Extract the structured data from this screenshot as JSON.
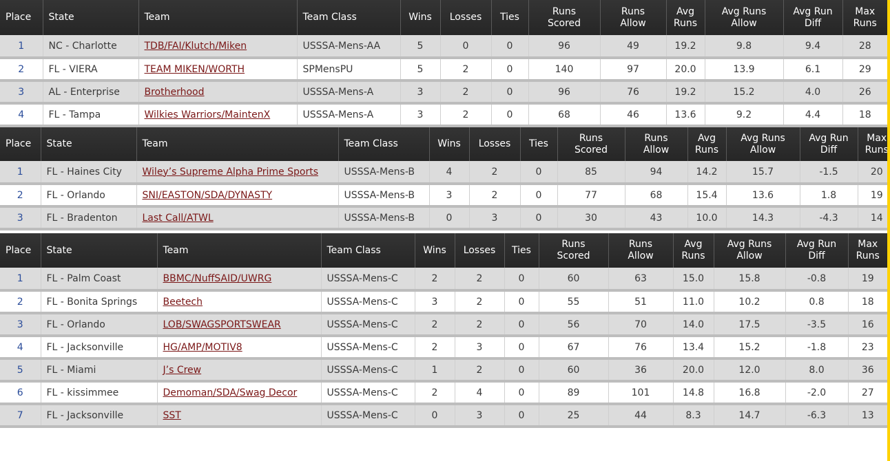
{
  "headers": [
    "Place",
    "State",
    "Team",
    "Team Class",
    "Wins",
    "Losses",
    "Ties",
    "Runs Scored",
    "Runs Allow",
    "Avg Runs",
    "Avg Runs Allow",
    "Avg Run Diff",
    "Max Runs"
  ],
  "headers_split": {
    "runs_scored": [
      "Runs",
      "Scored"
    ],
    "runs_allow": [
      "Runs",
      "Allow"
    ],
    "avg_runs": [
      "Avg",
      "Runs"
    ],
    "avg_runs_allow": [
      "Avg Runs",
      "Allow"
    ],
    "avg_run_diff": [
      "Avg Run",
      "Diff"
    ],
    "max_runs": [
      "Max",
      "Runs"
    ]
  },
  "tables": [
    {
      "rows": [
        {
          "place": "1",
          "state": "NC - Charlotte",
          "team": "TDB/FAI/Klutch/Miken",
          "team_class": "USSSA-Mens-AA",
          "wins": "5",
          "losses": "0",
          "ties": "0",
          "runs_scored": "96",
          "runs_allow": "49",
          "avg_runs": "19.2",
          "avg_runs_allow": "9.8",
          "avg_run_diff": "9.4",
          "max_runs": "28"
        },
        {
          "place": "2",
          "state": "FL - VIERA",
          "team": "TEAM MIKEN/WORTH",
          "team_class": "SPMensPU",
          "wins": "5",
          "losses": "2",
          "ties": "0",
          "runs_scored": "140",
          "runs_allow": "97",
          "avg_runs": "20.0",
          "avg_runs_allow": "13.9",
          "avg_run_diff": "6.1",
          "max_runs": "29"
        },
        {
          "place": "3",
          "state": "AL - Enterprise",
          "team": "Brotherhood",
          "team_class": "USSSA-Mens-A",
          "wins": "3",
          "losses": "2",
          "ties": "0",
          "runs_scored": "96",
          "runs_allow": "76",
          "avg_runs": "19.2",
          "avg_runs_allow": "15.2",
          "avg_run_diff": "4.0",
          "max_runs": "26"
        },
        {
          "place": "4",
          "state": "FL - Tampa",
          "team": "Wilkies Warriors/MaintenX",
          "team_class": "USSSA-Mens-A",
          "wins": "3",
          "losses": "2",
          "ties": "0",
          "runs_scored": "68",
          "runs_allow": "46",
          "avg_runs": "13.6",
          "avg_runs_allow": "9.2",
          "avg_run_diff": "4.4",
          "max_runs": "18"
        }
      ]
    },
    {
      "rows": [
        {
          "place": "1",
          "state": "FL - Haines City",
          "team": "Wiley’s Supreme Alpha Prime Sports",
          "team_class": "USSSA-Mens-B",
          "wins": "4",
          "losses": "2",
          "ties": "0",
          "runs_scored": "85",
          "runs_allow": "94",
          "avg_runs": "14.2",
          "avg_runs_allow": "15.7",
          "avg_run_diff": "-1.5",
          "max_runs": "20"
        },
        {
          "place": "2",
          "state": "FL - Orlando",
          "team": "SNI/EASTON/SDA/DYNASTY",
          "team_class": "USSSA-Mens-B",
          "wins": "3",
          "losses": "2",
          "ties": "0",
          "runs_scored": "77",
          "runs_allow": "68",
          "avg_runs": "15.4",
          "avg_runs_allow": "13.6",
          "avg_run_diff": "1.8",
          "max_runs": "19"
        },
        {
          "place": "3",
          "state": "FL - Bradenton",
          "team": "Last Call/ATWL",
          "team_class": "USSSA-Mens-B",
          "wins": "0",
          "losses": "3",
          "ties": "0",
          "runs_scored": "30",
          "runs_allow": "43",
          "avg_runs": "10.0",
          "avg_runs_allow": "14.3",
          "avg_run_diff": "-4.3",
          "max_runs": "14"
        }
      ]
    },
    {
      "rows": [
        {
          "place": "1",
          "state": "FL - Palm Coast",
          "team": "BBMC/NuffSAID/UWRG",
          "team_class": "USSSA-Mens-C",
          "wins": "2",
          "losses": "2",
          "ties": "0",
          "runs_scored": "60",
          "runs_allow": "63",
          "avg_runs": "15.0",
          "avg_runs_allow": "15.8",
          "avg_run_diff": "-0.8",
          "max_runs": "19"
        },
        {
          "place": "2",
          "state": "FL - Bonita Springs",
          "team": "Beetech",
          "team_class": "USSSA-Mens-C",
          "wins": "3",
          "losses": "2",
          "ties": "0",
          "runs_scored": "55",
          "runs_allow": "51",
          "avg_runs": "11.0",
          "avg_runs_allow": "10.2",
          "avg_run_diff": "0.8",
          "max_runs": "18"
        },
        {
          "place": "3",
          "state": "FL - Orlando",
          "team": "LOB/SWAGSPORTSWEAR",
          "team_class": "USSSA-Mens-C",
          "wins": "2",
          "losses": "2",
          "ties": "0",
          "runs_scored": "56",
          "runs_allow": "70",
          "avg_runs": "14.0",
          "avg_runs_allow": "17.5",
          "avg_run_diff": "-3.5",
          "max_runs": "16"
        },
        {
          "place": "4",
          "state": "FL - Jacksonville",
          "team": "HG/AMP/MOTIV8",
          "team_class": "USSSA-Mens-C",
          "wins": "2",
          "losses": "3",
          "ties": "0",
          "runs_scored": "67",
          "runs_allow": "76",
          "avg_runs": "13.4",
          "avg_runs_allow": "15.2",
          "avg_run_diff": "-1.8",
          "max_runs": "23"
        },
        {
          "place": "5",
          "state": "FL - Miami",
          "team": "J’s Crew",
          "team_class": "USSSA-Mens-C",
          "wins": "1",
          "losses": "2",
          "ties": "0",
          "runs_scored": "60",
          "runs_allow": "36",
          "avg_runs": "20.0",
          "avg_runs_allow": "12.0",
          "avg_run_diff": "8.0",
          "max_runs": "36"
        },
        {
          "place": "6",
          "state": "FL - kissimmee",
          "team": "Demoman/SDA/Swag Decor",
          "team_class": "USSSA-Mens-C",
          "wins": "2",
          "losses": "4",
          "ties": "0",
          "runs_scored": "89",
          "runs_allow": "101",
          "avg_runs": "14.8",
          "avg_runs_allow": "16.8",
          "avg_run_diff": "-2.0",
          "max_runs": "27"
        },
        {
          "place": "7",
          "state": "FL - Jacksonville",
          "team": "SST",
          "team_class": "USSSA-Mens-C",
          "wins": "0",
          "losses": "3",
          "ties": "0",
          "runs_scored": "25",
          "runs_allow": "44",
          "avg_runs": "8.3",
          "avg_runs_allow": "14.7",
          "avg_run_diff": "-6.3",
          "max_runs": "13"
        }
      ]
    }
  ]
}
